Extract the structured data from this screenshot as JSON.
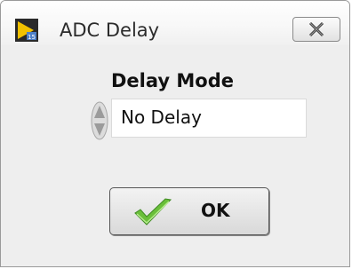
{
  "window": {
    "title": "ADC Delay"
  },
  "icons": {
    "app": "labview-vi-icon",
    "close": "close-icon",
    "stepper": "up-down-arrows-icon",
    "ok": "checkmark-icon"
  },
  "delay_mode": {
    "label": "Delay Mode",
    "value": "No Delay"
  },
  "buttons": {
    "ok_label": "OK"
  },
  "colors": {
    "check": "#6abf3a",
    "dialog_bg": "#eeeeee"
  }
}
